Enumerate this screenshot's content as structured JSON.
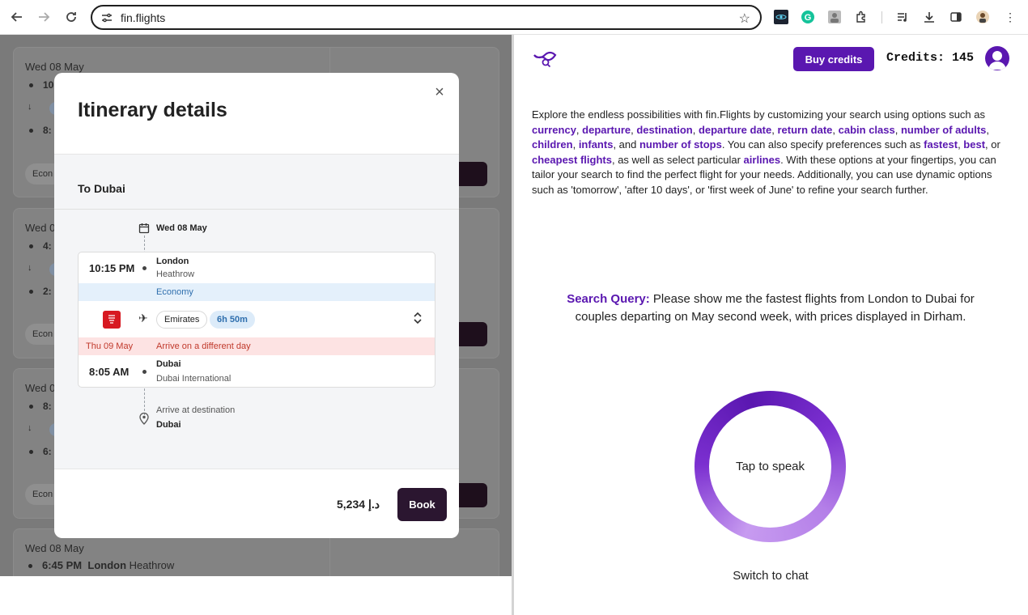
{
  "browser": {
    "url": "fin.flights"
  },
  "background_cards": [
    {
      "date": "Wed 08 May",
      "t1": "10",
      "t2": "8:",
      "econ": "Econ"
    },
    {
      "date": "Wed 0",
      "t1": "4:",
      "t2": "2:",
      "econ": "Econ"
    },
    {
      "date": "Wed 0",
      "t1": "8:",
      "t2": "6:",
      "econ": "Econ"
    },
    {
      "date": "Wed 08 May"
    }
  ],
  "background_last_row": {
    "time": "6:45 PM",
    "city": "London",
    "airport": "Heathrow"
  },
  "modal": {
    "title": "Itinerary details",
    "close_label": "×",
    "section_heading": "To Dubai",
    "depart_date": "Wed 08 May",
    "departure": {
      "time": "10:15 PM",
      "city": "London",
      "airport": "Heathrow"
    },
    "cabin": "Economy",
    "airline": "Emirates",
    "duration": "6h 50m",
    "arrival_day": "Thu 09 May",
    "arrival_notice": "Arrive on a different day",
    "arrival": {
      "time": "8:05 AM",
      "city": "Dubai",
      "airport": "Dubai International"
    },
    "destination_label": "Arrive at destination",
    "destination_city": "Dubai",
    "price": "5,234 د.إ",
    "book_label": "Book"
  },
  "header": {
    "buy_credits_label": "Buy credits",
    "credits_text": "Credits: 145"
  },
  "intro": {
    "p1": "Explore the endless possibilities with fin.Flights by customizing your search using options such as ",
    "h_currency": "currency",
    "h_departure": "departure",
    "h_destination": "destination",
    "h_departure_date": "departure date",
    "h_return_date": "return date",
    "h_cabin_class": "cabin class",
    "h_number_of_adults": "number of adults",
    "h_children": "children",
    "h_infants": "infants",
    "and": ", and ",
    "h_number_of_stops": "number of stops",
    "p2": ". You can also specify preferences such as ",
    "h_fastest": "fastest",
    "h_best": "best",
    "or": ", or ",
    "h_cheapest": "cheapest flights",
    "p3": ", as well as select particular ",
    "h_airlines": "airlines",
    "p4": ". With these options at your fingertips, you can tailor your search to find the perfect flight for your needs. Additionally, you can use dynamic options such as 'tomorrow', 'after 10 days', or 'first week of June' to refine your search further."
  },
  "query": {
    "label": "Search Query:",
    "text": " Please show me the fastest flights from London to Dubai for couples departing on May second week, with prices displayed in Dirham."
  },
  "voice": {
    "tap_label": "Tap to speak",
    "switch_label": "Switch to chat"
  },
  "colors": {
    "brand": "#5a17b0",
    "book_button": "#2b1630",
    "airline_red": "#d71921"
  },
  "icons": [
    "back-arrow-icon",
    "forward-arrow-icon",
    "reload-icon",
    "tune-icon",
    "star-icon",
    "extension-icons",
    "calendar-icon",
    "plane-icon",
    "chevron-updown-icon",
    "map-pin-icon",
    "close-icon",
    "avatar-icon",
    "logo-icon"
  ]
}
